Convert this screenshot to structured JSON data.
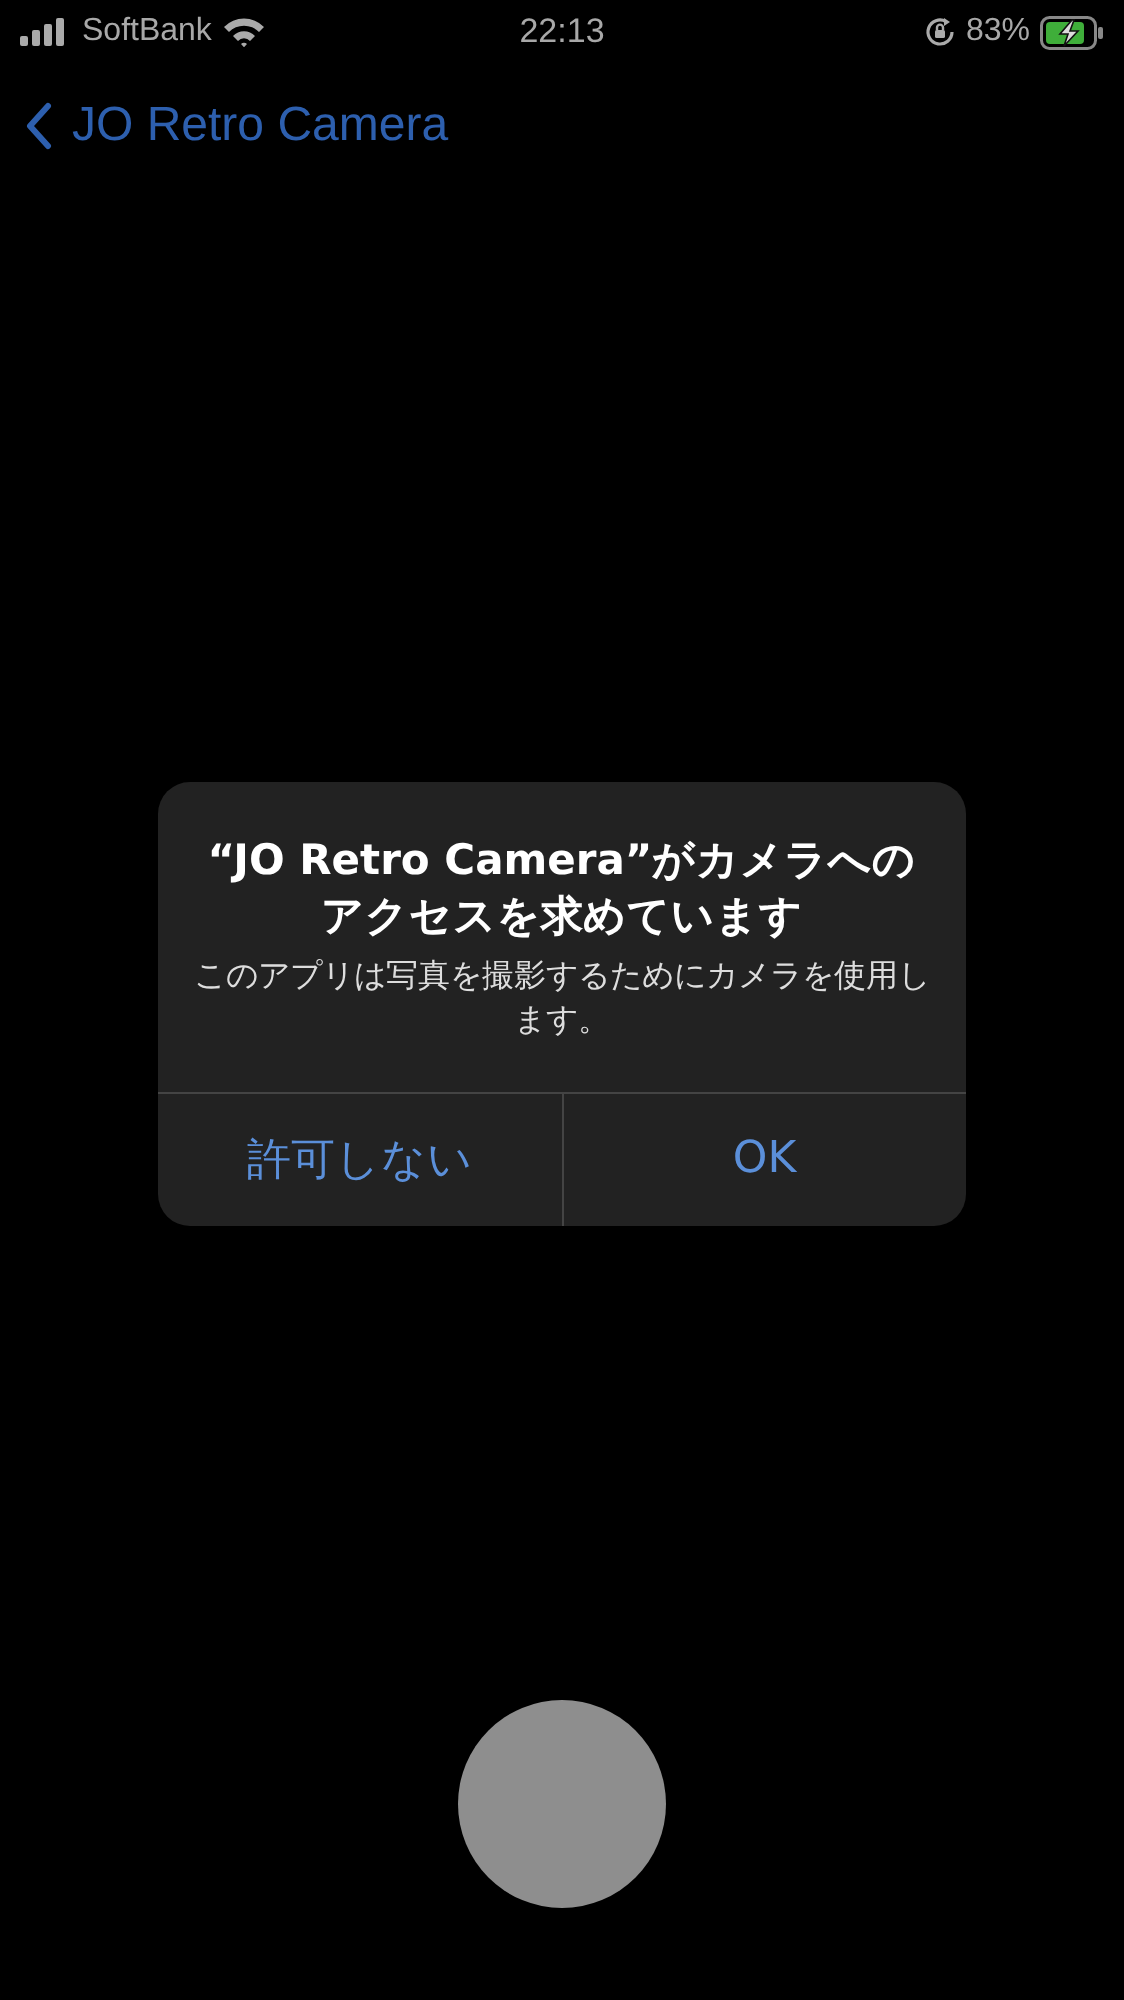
{
  "status_bar": {
    "carrier": "SoftBank",
    "time": "22:13",
    "battery": "83%"
  },
  "nav": {
    "back_label": "JO Retro Camera"
  },
  "alert": {
    "title": "“JO Retro Camera”がカメラへのアクセスを求めています",
    "message": "このアプリは写真を撮影するためにカメラを使用します。",
    "buttons": [
      {
        "label": "許可しない"
      },
      {
        "label": "OK"
      }
    ]
  }
}
